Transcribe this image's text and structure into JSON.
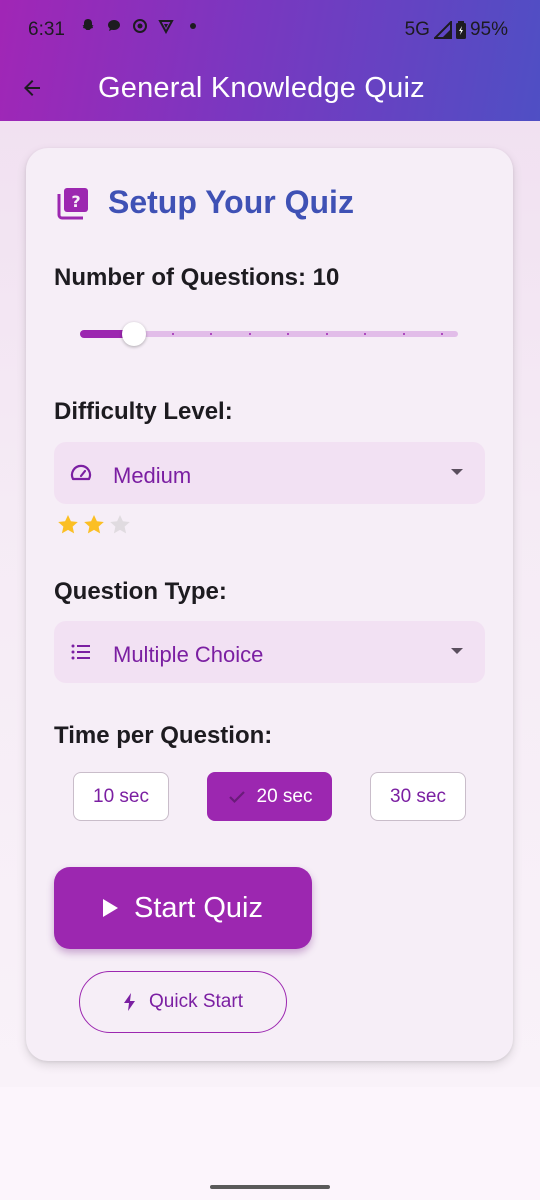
{
  "status_bar": {
    "time": "6:31",
    "network": "5G",
    "battery": "95%"
  },
  "app_bar": {
    "title": "General Knowledge Quiz",
    "back_icon": "arrow-back-icon"
  },
  "card": {
    "title": "Setup Your Quiz",
    "title_icon": "quiz-icon",
    "questions": {
      "label": "Number of Questions: 10",
      "value": 10,
      "min": 5,
      "max": 50,
      "divisions": 9
    },
    "difficulty": {
      "label": "Difficulty Level:",
      "selected": "Medium",
      "icon": "speedometer-icon",
      "stars_filled": 2,
      "stars_total": 3
    },
    "question_type": {
      "label": "Question Type:",
      "selected": "Multiple Choice",
      "icon": "list-icon"
    },
    "time": {
      "label": "Time per Question:",
      "options": [
        "10 sec",
        "20 sec",
        "30 sec"
      ],
      "selected_index": 1
    },
    "start_label": "Start Quiz",
    "quick_start_label": "Quick Start"
  },
  "colors": {
    "primary": "#9c27b0",
    "title_blue": "#3f51b5",
    "star": "#fbbf24"
  }
}
